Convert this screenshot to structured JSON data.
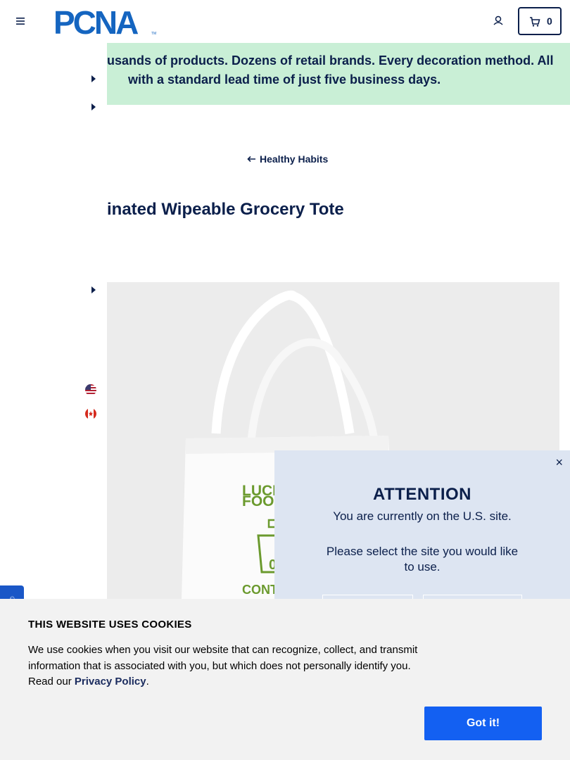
{
  "header": {
    "logo_text": "PCNA",
    "cart_count": "0"
  },
  "banner": {
    "line1": "usands of products. Dozens of retail brands. Every decoration method. All",
    "line2": "with a standard lead time of just five business days."
  },
  "breadcrumb": {
    "label": "Healthy Habits"
  },
  "product": {
    "title": "inated Wipeable Grocery Tote",
    "image_print_line1": "LUCK",
    "image_print_line2": "FOOD",
    "image_print_line3": "CONT"
  },
  "site_popup": {
    "title": "ATTENTION",
    "message": "You are currently on the U.S. site.",
    "prompt": "Please select the site you would like to use.",
    "close": "×"
  },
  "cookie": {
    "title": "THIS WEBSITE USES COOKIES",
    "text_before_link": "We use cookies when you visit our website that can recognize, collect, and transmit information that is associated with you, but which does not personally identify you. Read our ",
    "link": "Privacy Policy",
    "text_after_link": ".",
    "button": "Got it!"
  },
  "colors": {
    "navy": "#0b1f4b",
    "brand_blue": "#1360f2",
    "banner_green": "#c9efd6",
    "popup_bg": "#dde5f2"
  }
}
